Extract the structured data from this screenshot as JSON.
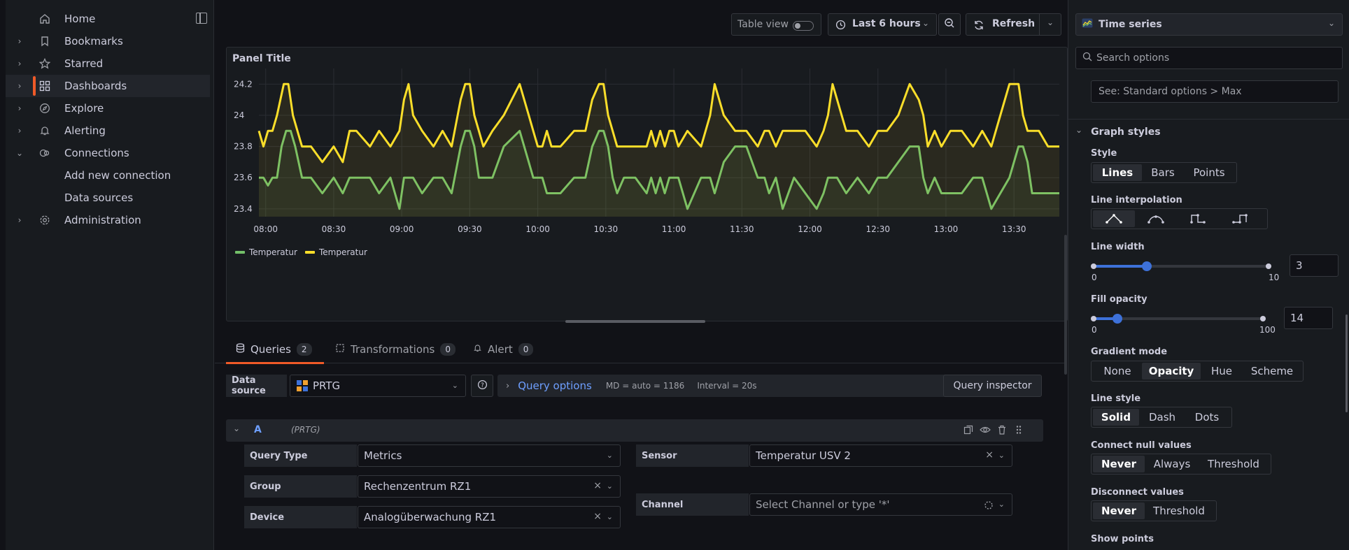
{
  "nav": {
    "items": [
      {
        "label": "Home",
        "icon": "home-icon",
        "chevron": ""
      },
      {
        "label": "Bookmarks",
        "icon": "bookmark-icon",
        "chevron": "›"
      },
      {
        "label": "Starred",
        "icon": "star-icon",
        "chevron": "›"
      },
      {
        "label": "Dashboards",
        "icon": "apps-icon",
        "chevron": "›"
      },
      {
        "label": "Explore",
        "icon": "compass-icon",
        "chevron": "›"
      },
      {
        "label": "Alerting",
        "icon": "bell-icon",
        "chevron": "›"
      },
      {
        "label": "Connections",
        "icon": "connections-icon",
        "chevron": "⌄"
      },
      {
        "label": "Add new connection",
        "icon": "",
        "chevron": ""
      },
      {
        "label": "Data sources",
        "icon": "",
        "chevron": ""
      },
      {
        "label": "Administration",
        "icon": "cog-icon",
        "chevron": "›"
      }
    ]
  },
  "toolbar": {
    "table_view": "Table view",
    "time_range": "Last 6 hours",
    "refresh": "Refresh"
  },
  "panel": {
    "title": "Panel Title"
  },
  "chart_data": {
    "type": "line",
    "title": "Panel Title",
    "ylim": [
      23.35,
      24.3
    ],
    "yticks": [
      "24.2",
      "24",
      "23.8",
      "23.6",
      "23.4"
    ],
    "xticks": [
      "08:00",
      "08:30",
      "09:00",
      "09:30",
      "10:00",
      "10:30",
      "11:00",
      "11:30",
      "12:00",
      "12:30",
      "13:00",
      "13:30"
    ],
    "legend_position": "bottom-left",
    "series": [
      {
        "name": "Temperatur",
        "color": "#73bf69",
        "x": [
          "07:57",
          "07:59",
          "08:01",
          "08:03",
          "08:05",
          "08:07",
          "08:09",
          "08:11",
          "08:13",
          "08:16",
          "08:20",
          "08:25",
          "08:30",
          "08:34",
          "08:37",
          "08:40",
          "08:46",
          "08:50",
          "08:55",
          "08:59",
          "09:01",
          "09:03",
          "09:05",
          "09:09",
          "09:14",
          "09:18",
          "09:22",
          "09:26",
          "09:28",
          "09:30",
          "09:32",
          "09:34",
          "09:36",
          "09:40",
          "09:45",
          "09:52",
          "09:56",
          "09:58",
          "10:00",
          "10:02",
          "10:04",
          "10:06",
          "10:10",
          "10:16",
          "10:21",
          "10:24",
          "10:27",
          "10:29",
          "10:31",
          "10:33",
          "10:35",
          "10:38",
          "10:43",
          "10:48",
          "10:50",
          "10:52",
          "10:54",
          "10:56",
          "10:58",
          "11:00",
          "11:02",
          "11:06",
          "11:12",
          "11:16",
          "11:18",
          "11:22",
          "11:27",
          "11:32",
          "11:37",
          "11:40",
          "11:42",
          "11:45",
          "11:48",
          "11:53",
          "11:58",
          "12:03",
          "12:06",
          "12:08",
          "12:10",
          "12:12",
          "12:16",
          "12:21",
          "12:26",
          "12:30",
          "12:34",
          "12:39",
          "12:44",
          "12:48",
          "12:50",
          "12:52",
          "12:55",
          "12:58",
          "13:02",
          "13:07",
          "13:12",
          "13:16",
          "13:20",
          "13:24",
          "13:28",
          "13:32",
          "13:34",
          "13:36",
          "13:38",
          "13:41",
          "13:45",
          "13:50"
        ],
        "y": [
          23.6,
          23.6,
          23.55,
          23.6,
          23.6,
          23.8,
          23.9,
          23.9,
          23.8,
          23.6,
          23.6,
          23.5,
          23.6,
          23.5,
          23.6,
          23.6,
          23.6,
          23.5,
          23.6,
          23.4,
          23.6,
          23.6,
          23.6,
          23.5,
          23.6,
          23.6,
          23.5,
          23.8,
          23.9,
          23.9,
          23.8,
          23.6,
          23.6,
          23.6,
          23.8,
          23.9,
          23.7,
          23.6,
          23.6,
          23.6,
          23.5,
          23.5,
          23.5,
          23.6,
          23.6,
          23.8,
          23.9,
          23.9,
          23.8,
          23.6,
          23.5,
          23.6,
          23.6,
          23.5,
          23.6,
          23.5,
          23.6,
          23.5,
          23.6,
          23.6,
          23.6,
          23.4,
          23.6,
          23.6,
          23.5,
          23.7,
          23.8,
          23.8,
          23.6,
          23.6,
          23.5,
          23.6,
          23.4,
          23.6,
          23.5,
          23.4,
          23.5,
          23.6,
          23.6,
          23.6,
          23.5,
          23.6,
          23.5,
          23.6,
          23.6,
          23.7,
          23.8,
          23.8,
          23.6,
          23.5,
          23.6,
          23.5,
          23.5,
          23.5,
          23.6,
          23.6,
          23.4,
          23.5,
          23.6,
          23.8,
          23.8,
          23.7,
          23.5,
          23.5,
          23.5,
          23.5
        ]
      },
      {
        "name": "Temperatur",
        "color": "#fade2a",
        "x": [
          "07:57",
          "07:59",
          "08:01",
          "08:03",
          "08:05",
          "08:08",
          "08:10",
          "08:12",
          "08:14",
          "08:16",
          "08:20",
          "08:25",
          "08:30",
          "08:34",
          "08:37",
          "08:40",
          "08:46",
          "08:50",
          "08:55",
          "08:59",
          "09:01",
          "09:03",
          "09:05",
          "09:09",
          "09:14",
          "09:18",
          "09:22",
          "09:26",
          "09:28",
          "09:30",
          "09:32",
          "09:34",
          "09:36",
          "09:40",
          "09:45",
          "09:52",
          "09:56",
          "09:58",
          "10:00",
          "10:02",
          "10:04",
          "10:06",
          "10:10",
          "10:16",
          "10:21",
          "10:24",
          "10:27",
          "10:29",
          "10:31",
          "10:33",
          "10:35",
          "10:38",
          "10:43",
          "10:48",
          "10:50",
          "10:52",
          "10:54",
          "10:56",
          "10:58",
          "11:00",
          "11:02",
          "11:06",
          "11:12",
          "11:16",
          "11:18",
          "11:22",
          "11:27",
          "11:32",
          "11:37",
          "11:40",
          "11:42",
          "11:45",
          "11:48",
          "11:53",
          "11:58",
          "12:03",
          "12:06",
          "12:08",
          "12:10",
          "12:12",
          "12:16",
          "12:21",
          "12:26",
          "12:30",
          "12:34",
          "12:39",
          "12:44",
          "12:48",
          "12:50",
          "12:52",
          "12:55",
          "12:58",
          "13:02",
          "13:07",
          "13:12",
          "13:16",
          "13:20",
          "13:24",
          "13:28",
          "13:32",
          "13:34",
          "13:36",
          "13:38",
          "13:41",
          "13:45",
          "13:50"
        ],
        "y": [
          23.9,
          23.8,
          23.9,
          23.9,
          24.0,
          24.2,
          24.2,
          24.0,
          23.9,
          23.8,
          23.8,
          23.7,
          23.8,
          23.7,
          23.9,
          23.9,
          23.8,
          23.9,
          23.8,
          23.9,
          24.1,
          24.2,
          24.0,
          23.9,
          23.8,
          23.9,
          23.8,
          24.1,
          24.2,
          24.2,
          24.0,
          23.9,
          23.8,
          23.9,
          24.0,
          24.2,
          24.0,
          23.9,
          23.8,
          23.8,
          23.9,
          23.8,
          23.8,
          23.9,
          23.9,
          24.1,
          24.2,
          24.2,
          24.0,
          23.9,
          23.8,
          23.8,
          23.8,
          23.8,
          23.9,
          23.8,
          23.9,
          23.8,
          23.9,
          23.9,
          23.8,
          23.9,
          23.8,
          24.0,
          24.2,
          24.0,
          23.9,
          23.9,
          23.8,
          23.9,
          23.9,
          23.8,
          23.9,
          23.9,
          23.9,
          23.8,
          23.9,
          24.0,
          24.2,
          24.1,
          23.9,
          23.9,
          23.8,
          23.9,
          23.9,
          24.0,
          24.2,
          24.1,
          24.0,
          23.8,
          23.9,
          23.8,
          23.9,
          23.9,
          23.8,
          23.9,
          23.8,
          24.0,
          24.2,
          24.2,
          24.0,
          23.9,
          23.9,
          23.9,
          23.8,
          23.8
        ]
      }
    ]
  },
  "query_tabs": [
    {
      "label": "Queries",
      "count": "2"
    },
    {
      "label": "Transformations",
      "count": "0"
    },
    {
      "label": "Alert",
      "count": "0"
    }
  ],
  "datasource": {
    "label": "Data source",
    "value": "PRTG",
    "query_options": "Query options",
    "md": "MD = auto = 1186",
    "interval": "Interval = 20s",
    "inspector": "Query inspector"
  },
  "query": {
    "ref": "A",
    "ds": "(PRTG)",
    "query_type_label": "Query Type",
    "query_type_value": "Metrics",
    "group_label": "Group",
    "group_value": "Rechenzentrum RZ1",
    "device_label": "Device",
    "device_value": "Analogüberwachung RZ1",
    "sensor_label": "Sensor",
    "sensor_value": "Temperatur USV 2",
    "channel_label": "Channel",
    "channel_placeholder": "Select Channel or type '*'"
  },
  "options": {
    "viz": "Time series",
    "search_placeholder": "Search options",
    "max_placeholder": "See: Standard options > Max",
    "graph_styles": "Graph styles",
    "style_label": "Style",
    "style_options": [
      "Lines",
      "Bars",
      "Points"
    ],
    "line_interp_label": "Line interpolation",
    "line_width_label": "Line width",
    "line_width_value": "3",
    "line_width_min": "0",
    "line_width_max": "10",
    "line_width_fraction": 0.3,
    "fill_opacity_label": "Fill opacity",
    "fill_opacity_value": "14",
    "fill_opacity_min": "0",
    "fill_opacity_max": "100",
    "fill_opacity_fraction": 0.14,
    "gradient_label": "Gradient mode",
    "gradient_options": [
      "None",
      "Opacity",
      "Hue",
      "Scheme"
    ],
    "line_style_label": "Line style",
    "line_style_options": [
      "Solid",
      "Dash",
      "Dots"
    ],
    "connect_null_label": "Connect null values",
    "connect_null_options": [
      "Never",
      "Always",
      "Threshold"
    ],
    "disconnect_label": "Disconnect values",
    "disconnect_options": [
      "Never",
      "Threshold"
    ],
    "show_points_label": "Show points"
  },
  "colors": {
    "accent": "#f05a28",
    "blue": "#3d71d9",
    "link": "#6e9fff"
  }
}
